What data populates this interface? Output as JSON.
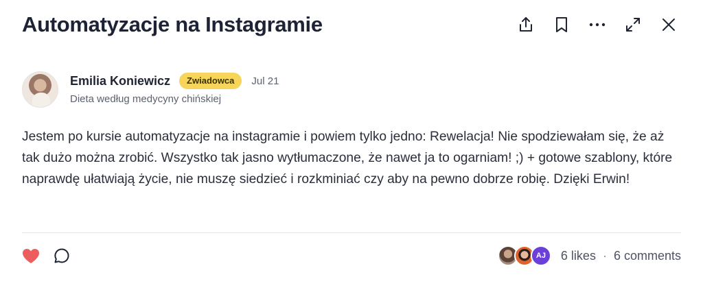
{
  "post": {
    "title": "Automatyzacje na Instagramie",
    "author": {
      "name": "Emilia Koniewicz",
      "badge": "Zwiadowca",
      "date": "Jul 21",
      "subtitle": "Dieta według medycyny chińskiej"
    },
    "body": "Jestem po kursie automatyzacje na instagramie i powiem tylko jedno: Rewelacja! Nie spodziewałam się, że aż tak dużo można zrobić. Wszystko tak jasno wytłumaczone, że nawet ja to ogarniam! ;) + gotowe szablony, które naprawdę ułatwiają życie, nie muszę siedzieć i rozkminiać czy aby na pewno dobrze robię. Dzięki Erwin!"
  },
  "toolbar": {
    "icons": [
      "share-icon",
      "bookmark-icon",
      "more-icon",
      "expand-icon",
      "close-icon"
    ]
  },
  "footer": {
    "liker_initials": "AJ",
    "likes": "6 likes",
    "separator": "·",
    "comments": "6 comments"
  },
  "colors": {
    "badge_bg": "#f6d55a",
    "heart": "#ec5e5e",
    "initials_avatar": "#6b40d8"
  }
}
